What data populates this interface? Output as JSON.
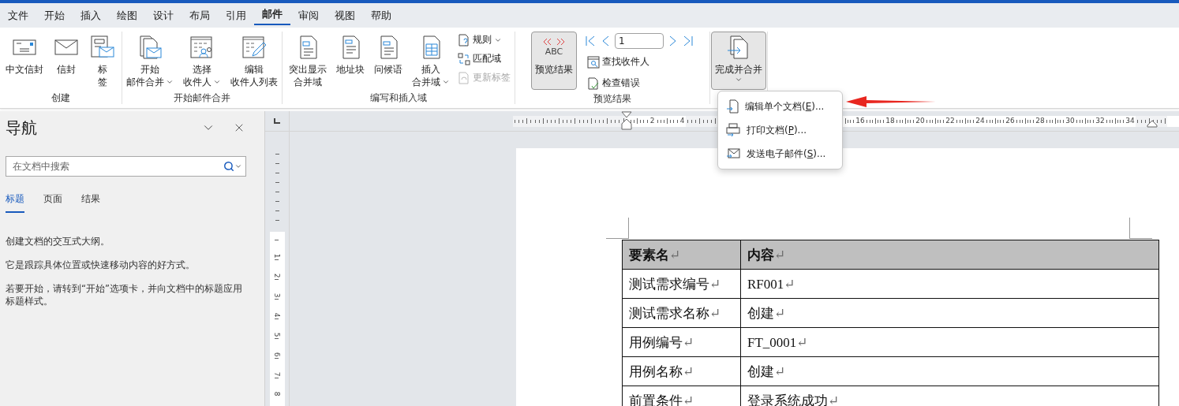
{
  "ribbon_tabs": [
    {
      "label": "文件",
      "selected": false
    },
    {
      "label": "开始",
      "selected": false
    },
    {
      "label": "插入",
      "selected": false
    },
    {
      "label": "绘图",
      "selected": false
    },
    {
      "label": "设计",
      "selected": false
    },
    {
      "label": "布局",
      "selected": false
    },
    {
      "label": "引用",
      "selected": false
    },
    {
      "label": "邮件",
      "selected": true
    },
    {
      "label": "审阅",
      "selected": false
    },
    {
      "label": "视图",
      "selected": false
    },
    {
      "label": "帮助",
      "selected": false
    }
  ],
  "ribbon_groups": [
    {
      "label": "创建",
      "items": [
        {
          "kind": "large",
          "lines": [
            "中文信封"
          ],
          "dropdown": false,
          "pressed": false
        },
        {
          "kind": "large",
          "lines": [
            "信封"
          ],
          "dropdown": false,
          "pressed": false
        },
        {
          "kind": "large",
          "lines": [
            "标",
            "签"
          ],
          "dropdown": false,
          "pressed": false
        }
      ]
    },
    {
      "label": "开始邮件合并",
      "items": [
        {
          "kind": "large",
          "lines": [
            "开始",
            "邮件合并"
          ],
          "dropdown": true,
          "pressed": false
        },
        {
          "kind": "large",
          "lines": [
            "选择",
            "收件人"
          ],
          "dropdown": true,
          "pressed": false
        },
        {
          "kind": "large",
          "lines": [
            "编辑",
            "收件人列表"
          ],
          "dropdown": false,
          "pressed": false
        }
      ]
    },
    {
      "label": "编写和插入域",
      "items": [
        {
          "kind": "large",
          "lines": [
            "突出显示",
            "合并域"
          ],
          "dropdown": false,
          "pressed": false
        },
        {
          "kind": "large",
          "lines": [
            "地址块"
          ],
          "dropdown": false,
          "pressed": false
        },
        {
          "kind": "large",
          "lines": [
            "问候语"
          ],
          "dropdown": false,
          "pressed": false
        },
        {
          "kind": "large",
          "lines": [
            "插入",
            "合并域"
          ],
          "dropdown": true,
          "pressed": false
        },
        {
          "kind": "small_stack",
          "buttons": [
            {
              "label": "规则",
              "dropdown": true,
              "disabled": false
            },
            {
              "label": "匹配域",
              "dropdown": false,
              "disabled": false
            },
            {
              "label": "更新标签",
              "dropdown": false,
              "disabled": true
            }
          ]
        }
      ]
    },
    {
      "label": "预览结果",
      "items": [
        {
          "kind": "large",
          "lines": [
            "预览结果"
          ],
          "badge": "ABC",
          "dropdown": false,
          "pressed": true
        },
        {
          "kind": "record_nav",
          "value": "1",
          "buttons": [
            {
              "label": "查找收件人",
              "dropdown": false,
              "disabled": false
            },
            {
              "label": "检查错误",
              "dropdown": false,
              "disabled": false
            }
          ]
        }
      ]
    },
    {
      "items": [
        {
          "kind": "large",
          "lines": [
            "完成并合并"
          ],
          "dropdown": true,
          "pressed": true
        }
      ]
    }
  ],
  "finish_menu": [
    {
      "before": "编辑单个文档(",
      "key": "E",
      "after": ")..."
    },
    {
      "before": "打印文档(",
      "key": "P",
      "after": ")..."
    },
    {
      "before": "发送电子邮件(",
      "key": "S",
      "after": ")..."
    }
  ],
  "navigation": {
    "title": "导航",
    "search": {
      "placeholder": "在文档中搜索"
    },
    "tabs": [
      {
        "label": "标题",
        "selected": true
      },
      {
        "label": "页面",
        "selected": false
      },
      {
        "label": "结果",
        "selected": false
      }
    ],
    "paragraphs": [
      "创建文档的交互式大纲。",
      "它是跟踪具体位置或快速移动内容的好方式。",
      "若要开始，请转到“开始”选项卡，并向文档中的标题应用标题样式。"
    ]
  },
  "horizontal_ruler": {
    "left_labels": [
      "2",
      "4"
    ],
    "right_labels": [
      "16",
      "18",
      "20",
      "22",
      "24",
      "26",
      "28",
      "30",
      "32",
      "34"
    ]
  },
  "vertical_ruler": {
    "labels": [
      "1",
      "2",
      "3",
      "4",
      "5",
      "6",
      "7",
      "8"
    ]
  },
  "document": {
    "table": {
      "header": [
        {
          "text": "要素名",
          "mark": "↵"
        },
        {
          "text": "内容",
          "mark": "↵"
        }
      ],
      "rows": [
        [
          {
            "text": "测试需求编号",
            "mark": "↵"
          },
          {
            "text": "RF001",
            "mark": "↵"
          }
        ],
        [
          {
            "text": "测试需求名称",
            "mark": "↵"
          },
          {
            "text": "创建",
            "mark": "↵"
          }
        ],
        [
          {
            "text": "用例编号",
            "mark": "↵"
          },
          {
            "text": "FT_0001",
            "mark": "↵"
          }
        ],
        [
          {
            "text": "用例名称",
            "mark": "↵"
          },
          {
            "text": "创建",
            "mark": "↵"
          }
        ],
        [
          {
            "text": "前置条件",
            "mark": "↵"
          },
          {
            "text": "登录系统成功",
            "mark": "↵"
          }
        ]
      ]
    }
  }
}
